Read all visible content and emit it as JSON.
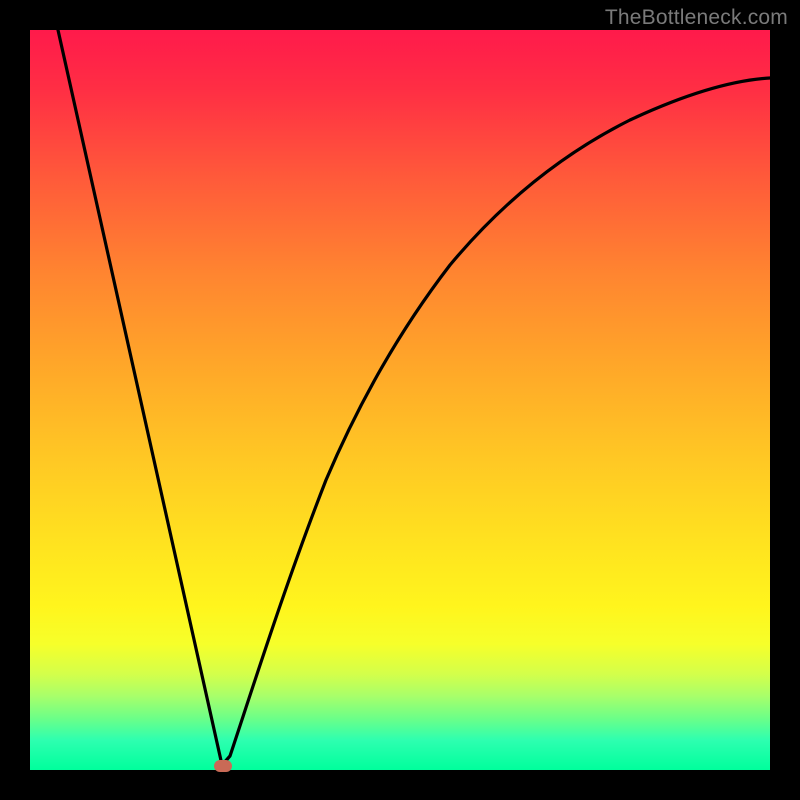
{
  "attribution": "TheBottleneck.com",
  "colors": {
    "frame": "#000000",
    "gradient_top": "#ff1a4b",
    "gradient_bottom": "#00ff9c",
    "curve": "#000000",
    "marker": "#c96a56"
  },
  "chart_data": {
    "type": "line",
    "title": "",
    "xlabel": "",
    "ylabel": "",
    "xlim": [
      0,
      100
    ],
    "ylim": [
      0,
      100
    ],
    "note": "axes unlabeled; values are pixel-relative estimates on a 0–100 scale",
    "marker": {
      "x": 26,
      "y": 0
    },
    "series": [
      {
        "name": "curve",
        "x": [
          0,
          5,
          10,
          15,
          20,
          25,
          26,
          27,
          30,
          35,
          40,
          45,
          50,
          55,
          60,
          65,
          70,
          75,
          80,
          85,
          90,
          95,
          100
        ],
        "y": [
          100,
          81,
          62,
          42,
          23,
          4,
          0,
          3,
          14,
          31,
          45,
          56,
          64,
          71,
          76,
          80,
          83,
          86,
          88,
          90,
          91,
          92,
          93
        ]
      }
    ]
  }
}
